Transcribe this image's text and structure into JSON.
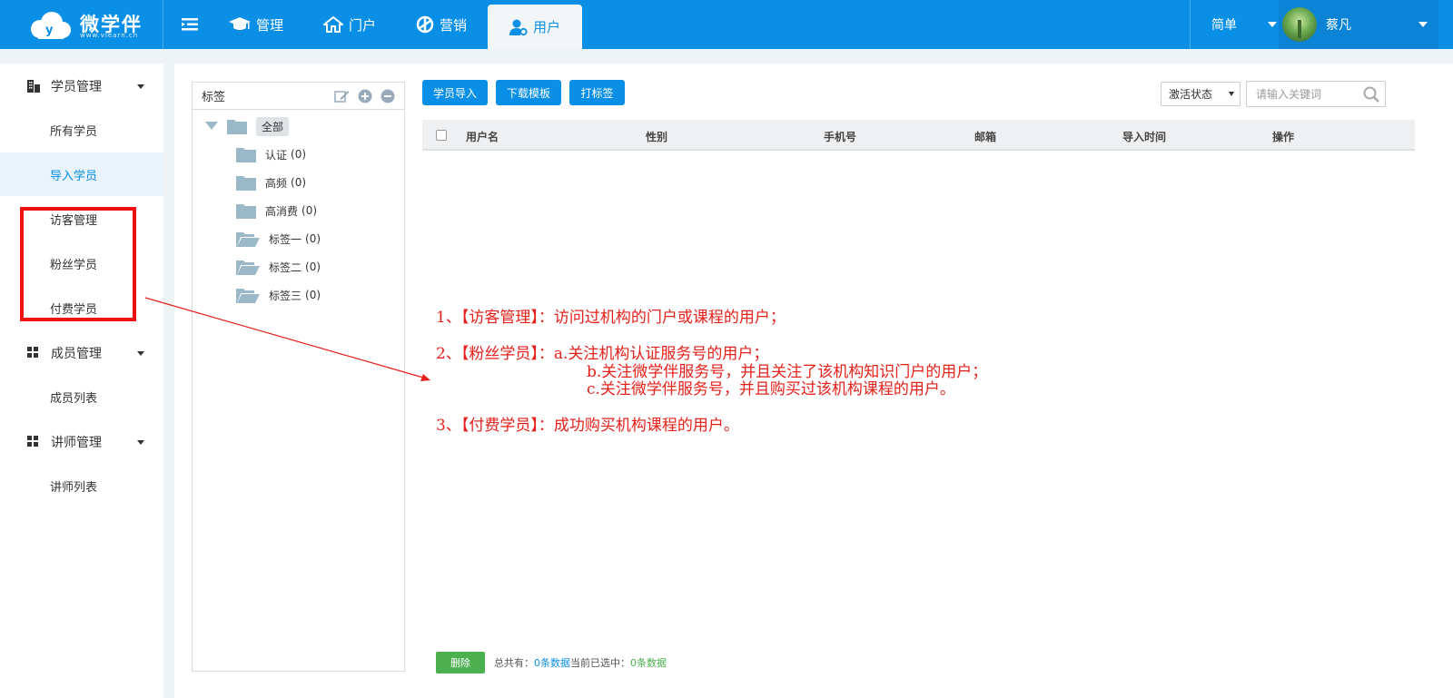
{
  "header": {
    "logo_text": "微学伴",
    "logo_sub": "www.vlearn.cn",
    "nav": [
      {
        "label": "管理",
        "icon": "graduation-cap-icon"
      },
      {
        "label": "门户",
        "icon": "home-icon"
      },
      {
        "label": "营销",
        "icon": "aperture-icon"
      },
      {
        "label": "用户",
        "icon": "user-gear-icon",
        "active": true
      }
    ],
    "mode": "简单",
    "username": "蔡凡"
  },
  "sidebar": {
    "groups": [
      {
        "label": "学员管理",
        "icon": "building-icon",
        "items": [
          "所有学员",
          "导入学员",
          "访客管理",
          "粉丝学员",
          "付费学员"
        ]
      },
      {
        "label": "成员管理",
        "icon": "grid-icon",
        "items": [
          "成员列表"
        ]
      },
      {
        "label": "讲师管理",
        "icon": "grid-icon",
        "items": [
          "讲师列表"
        ]
      }
    ],
    "active_item": "导入学员"
  },
  "tags": {
    "title": "标签",
    "root": "全部",
    "items": [
      {
        "name": "认证",
        "count": "(0)"
      },
      {
        "name": "高频",
        "count": "(0)"
      },
      {
        "name": "高消费",
        "count": "(0)"
      },
      {
        "name": "标签一",
        "count": "(0)"
      },
      {
        "name": "标签二",
        "count": "(0)"
      },
      {
        "name": "标签三",
        "count": "(0)"
      }
    ]
  },
  "toolbar": {
    "import_label": "学员导入",
    "template_label": "下载模板",
    "tag_label": "打标签",
    "status_select": "激活状态",
    "search_placeholder": "请输入关键词"
  },
  "table": {
    "columns": [
      "用户名",
      "性别",
      "手机号",
      "邮箱",
      "导入时间",
      "操作"
    ]
  },
  "annotation": {
    "line1": "1、【访客管理】：访问过机构的门户或课程的用户；",
    "line2a": "2、【粉丝学员】：a.关注机构认证服务号的用户；",
    "line2b": "b.关注微学伴服务号，并且关注了该机构知识门户的用户；",
    "line2c": "c.关注微学伴服务号，并且购买过该机构课程的用户。",
    "line3": "3、【付费学员】：成功购买机构课程的用户。"
  },
  "footer": {
    "delete_label": "删除",
    "total_prefix": "总共有：",
    "total_value": "0条数据",
    "selected_prefix": " 当前已选中：",
    "selected_value": "0条数据"
  },
  "colors": {
    "primary": "#0a8fe6",
    "annotation_red": "#e5201a",
    "delete_green": "#4caf50"
  }
}
